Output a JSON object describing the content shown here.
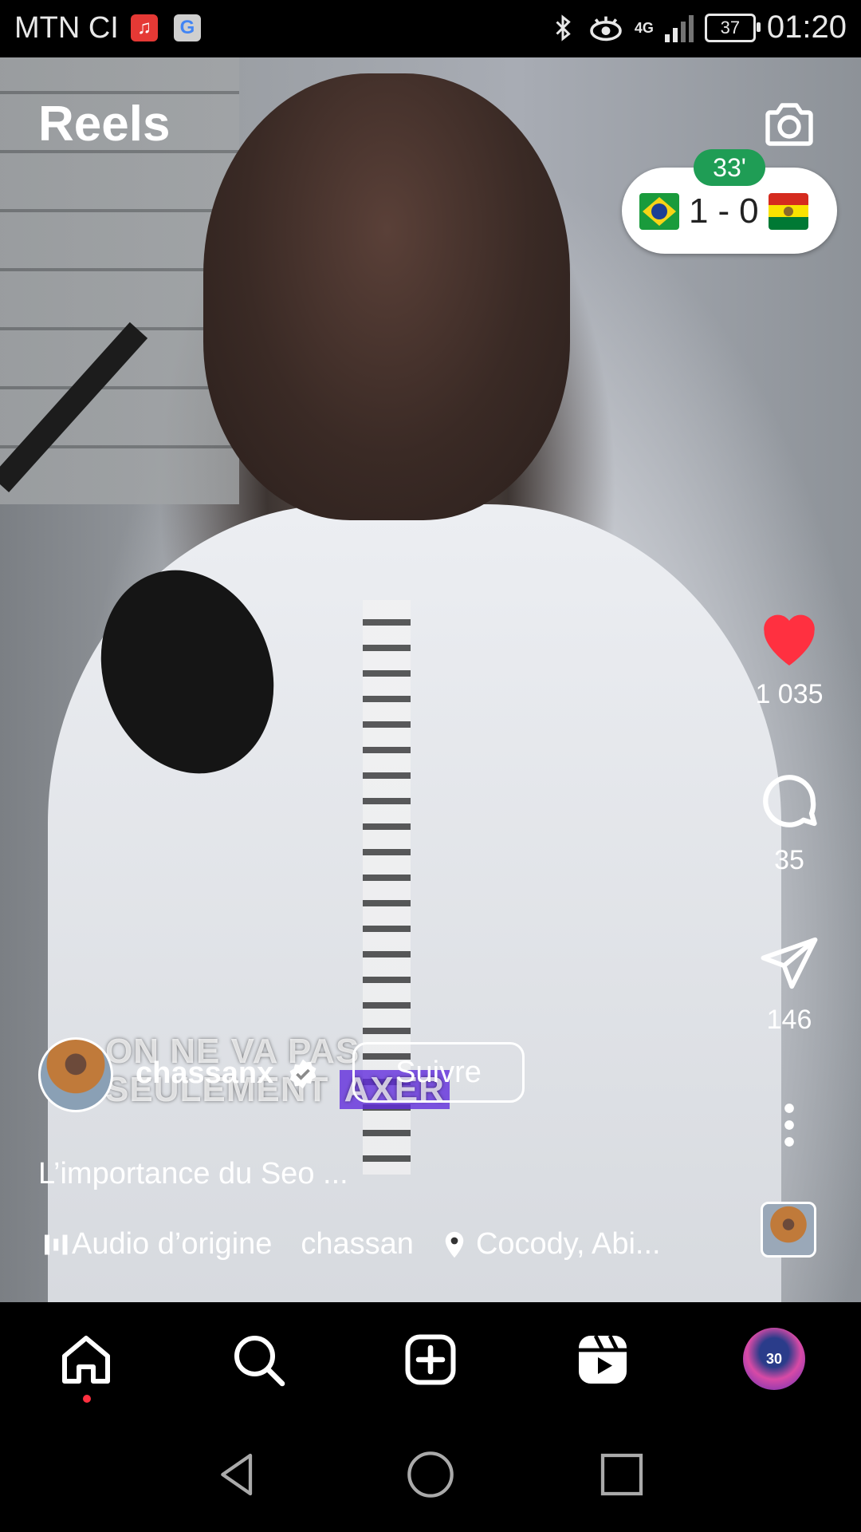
{
  "status_bar": {
    "carrier": "MTN CI",
    "network": "4G",
    "battery": "37",
    "time": "01:20"
  },
  "header": {
    "title": "Reels"
  },
  "score_widget": {
    "minute": "33'",
    "home_score": "1",
    "separator": "-",
    "away_score": "0"
  },
  "video_overlay": {
    "line1": "ON NE VA PAS",
    "line2_a": "SEULEMENT",
    "line2_b": "AXER"
  },
  "actions": {
    "likes": "1 035",
    "comments": "35",
    "shares": "146"
  },
  "post": {
    "username": "chassanx",
    "follow_label": "Suivre",
    "caption": "L’importance du Seo ...",
    "audio_label": "Audio d’origine",
    "audio_author": "chassan",
    "location": "Cocody, Abi..."
  },
  "profile": {
    "jersey_number": "30"
  },
  "colors": {
    "like_red": "#ff3040",
    "score_minute_green": "#1f9d55",
    "overlay_highlight": "#622ddc"
  }
}
